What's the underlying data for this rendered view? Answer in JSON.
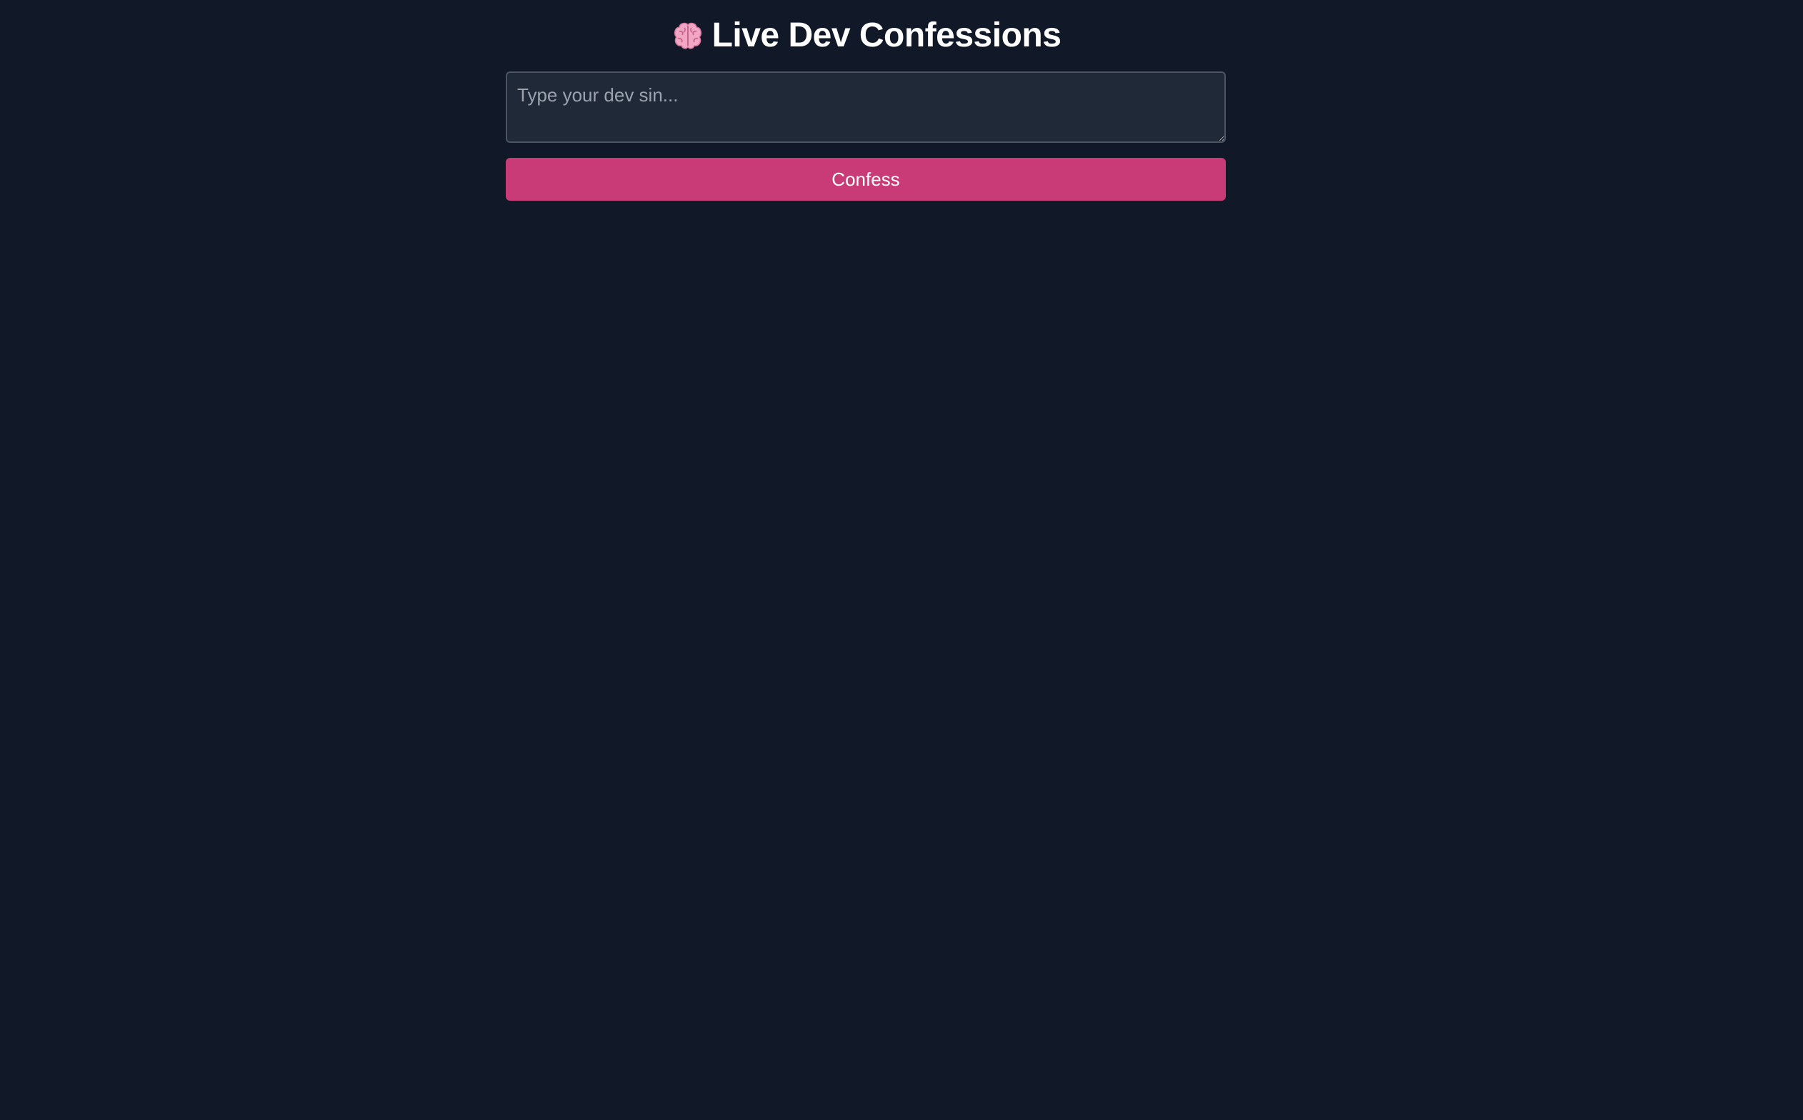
{
  "header": {
    "title": "Live Dev Confessions",
    "icon": "brain-icon"
  },
  "form": {
    "input_value": "",
    "input_placeholder": "Type your dev sin...",
    "submit_label": "Confess"
  },
  "colors": {
    "background": "#111827",
    "input_background": "#1f2937",
    "input_border": "#4b5563",
    "button_accent": "#c93b77",
    "title_text": "#ffffff"
  }
}
